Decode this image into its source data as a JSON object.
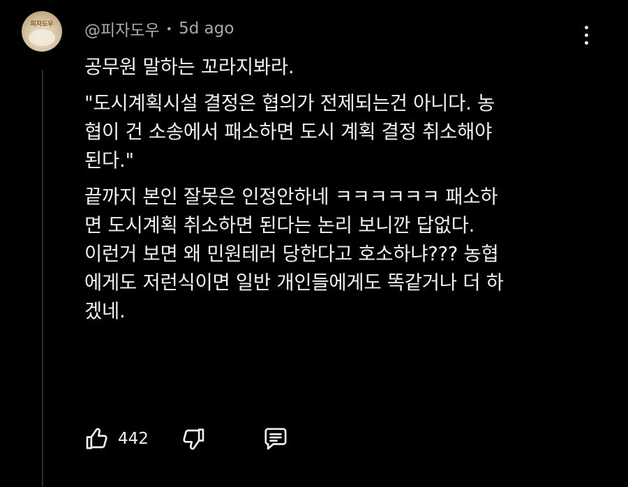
{
  "comment": {
    "author": "@피자도우",
    "separator": "•",
    "time": "5d ago",
    "avatar_text": "피자도우",
    "lines": [
      "공무원 말하는 꼬라지봐라.",
      "\"도시계획시설 결정은 협의가 전제되는건 아니다. 농",
      "협이 건 소송에서 패소하면 도시 계획 결정 취소해야",
      "된다.\"",
      "끝까지 본인 잘못은 인정안하네 ㅋㅋㅋㅋㅋㅋ  패소하",
      "면 도시계획 취소하면 된다는 논리 보니깐 답없다.",
      "이런거 보면 왜 민원테러 당한다고 호소하냐???  농협",
      "에게도 저런식이면 일반 개인들에게도 똑같거나 더 하",
      "겠네."
    ]
  },
  "actions": {
    "like_count": "442",
    "like_icon": "thumb-up-outline",
    "dislike_icon": "thumb-down-outline",
    "reply_icon": "comment-outline"
  },
  "colors": {
    "background": "#000000",
    "text": "#f1f1f1",
    "meta": "#aaaaaa"
  }
}
